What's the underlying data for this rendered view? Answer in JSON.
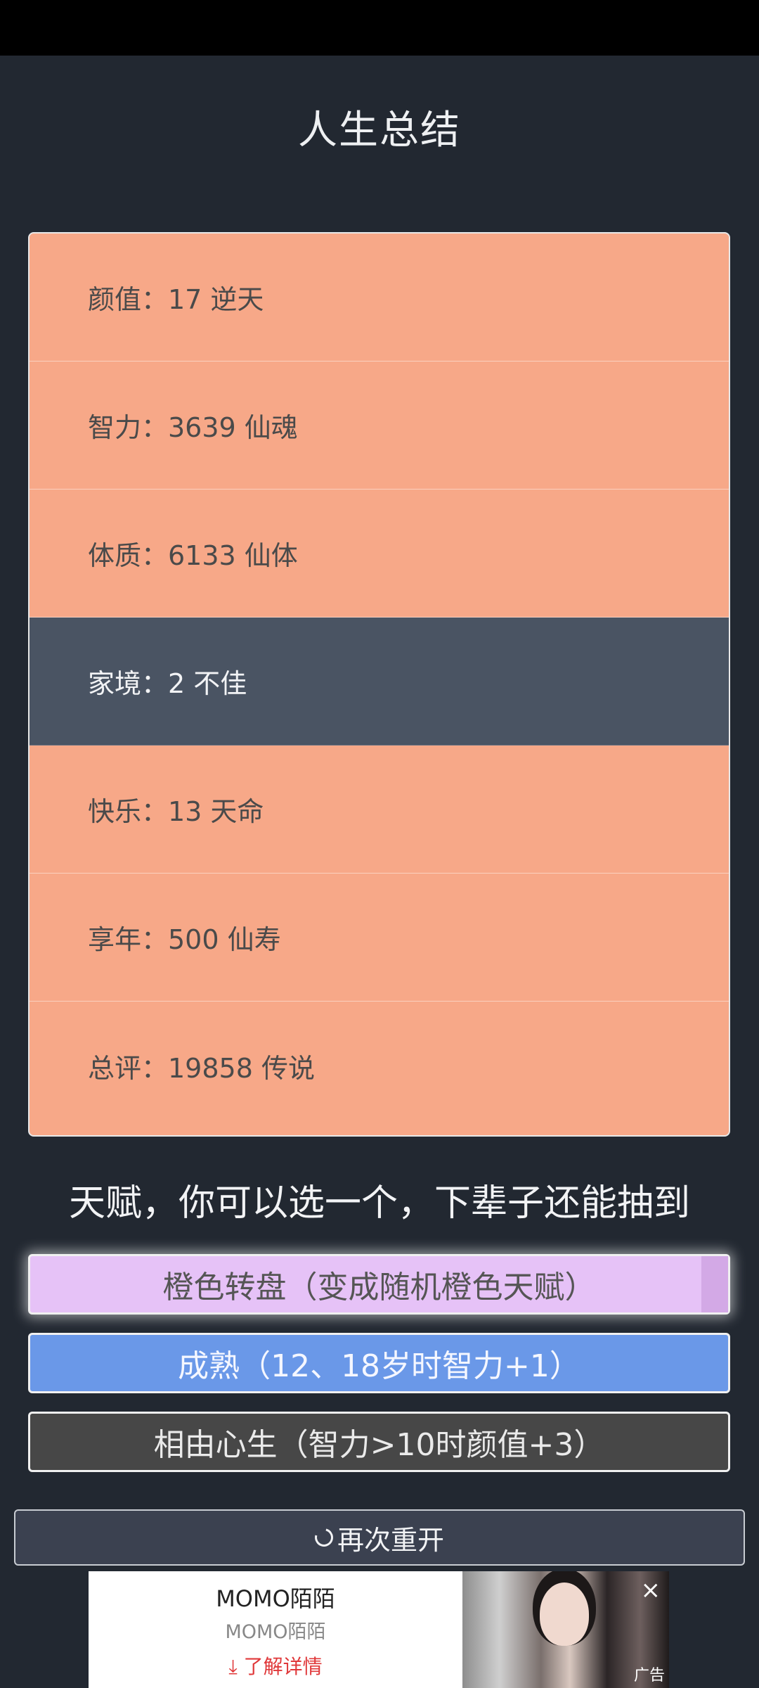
{
  "page": {
    "title": "人生总结"
  },
  "summary": {
    "rows": [
      {
        "label": "颜值：17 逆天"
      },
      {
        "label": "智力：3639 仙魂"
      },
      {
        "label": "体质：6133 仙体"
      },
      {
        "label": "家境：2 不佳"
      },
      {
        "label": "快乐：13 天命"
      },
      {
        "label": "享年：500 仙寿"
      },
      {
        "label": "总评：19858 传说"
      }
    ]
  },
  "talents": {
    "heading": "天赋，你可以选一个，下辈子还能抽到",
    "options": [
      {
        "label": "橙色转盘（变成随机橙色天赋）",
        "color": "#e6c2f7"
      },
      {
        "label": "成熟（12、18岁时智力+1）",
        "color": "#6a98e8"
      },
      {
        "label": "相由心生（智力>10时颜值+3）",
        "color": "#474747"
      }
    ]
  },
  "restart": {
    "label": "再次重开",
    "icon": "refresh-icon"
  },
  "ad": {
    "title": "MOMO陌陌",
    "subtitle": "MOMO陌陌",
    "link": "了解详情",
    "link_icon": "download-icon",
    "close": "×",
    "label": "广告"
  },
  "colors": {
    "background": "#222831",
    "row_orange": "#f7a888",
    "row_dark": "#4a5463"
  }
}
